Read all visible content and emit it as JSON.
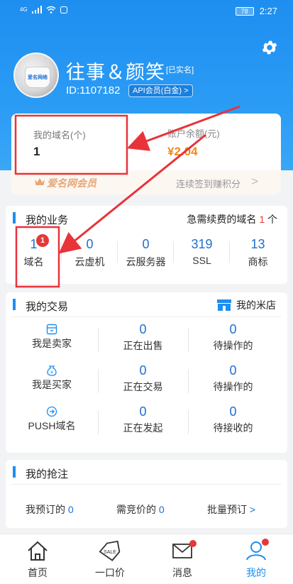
{
  "statusbar": {
    "signal": "4G",
    "battery": "78",
    "time": "2:27"
  },
  "profile": {
    "name": "往事＆颜笑",
    "verified_tag": "[已实名]",
    "id_text": "ID:1107182",
    "vip_text": "API会员(白金) >",
    "avatar_text": "爱名网络"
  },
  "account": {
    "domains_label": "我的域名(个)",
    "domains_value": "1",
    "balance_label": "账户余额(元)",
    "balance_value": "¥2.04",
    "member_text": "爱名网会员",
    "sign_text": "连续签到赚积分"
  },
  "business": {
    "title": "我的业务",
    "urgent_prefix": "急需续费的域名",
    "urgent_count": "1",
    "urgent_suffix": "个",
    "items": [
      {
        "num": "1",
        "label": "域名",
        "badge": "1"
      },
      {
        "num": "0",
        "label": "云虚机"
      },
      {
        "num": "0",
        "label": "云服务器"
      },
      {
        "num": "319",
        "label": "SSL"
      },
      {
        "num": "13",
        "label": "商标"
      }
    ]
  },
  "trade": {
    "title": "我的交易",
    "mall": "我的米店",
    "rows": [
      {
        "role": "我是卖家",
        "icon": "shop-icon",
        "a_num": "0",
        "a_label": "正在出售",
        "b_num": "0",
        "b_label": "待操作的"
      },
      {
        "role": "我是买家",
        "icon": "money-bag-icon",
        "a_num": "0",
        "a_label": "正在交易",
        "b_num": "0",
        "b_label": "待操作的"
      },
      {
        "role": "PUSH域名",
        "icon": "arrow-circle-icon",
        "a_num": "0",
        "a_label": "正在发起",
        "b_num": "0",
        "b_label": "待接收的"
      }
    ]
  },
  "grab": {
    "title": "我的抢注",
    "reserved_label": "我预订的",
    "reserved_num": "0",
    "bid_label": "需竞价的",
    "bid_num": "0",
    "batch_label": "批量预订",
    "batch_arrow": ">"
  },
  "nav": {
    "items": [
      {
        "label": "首页",
        "icon": "home-icon"
      },
      {
        "label": "一口价",
        "icon": "sale-tag-icon"
      },
      {
        "label": "消息",
        "icon": "mail-icon"
      },
      {
        "label": "我的",
        "icon": "user-icon"
      }
    ]
  },
  "colors": {
    "primary": "#1e8ef0",
    "accent": "#e53935",
    "orange": "#f08a1c"
  }
}
